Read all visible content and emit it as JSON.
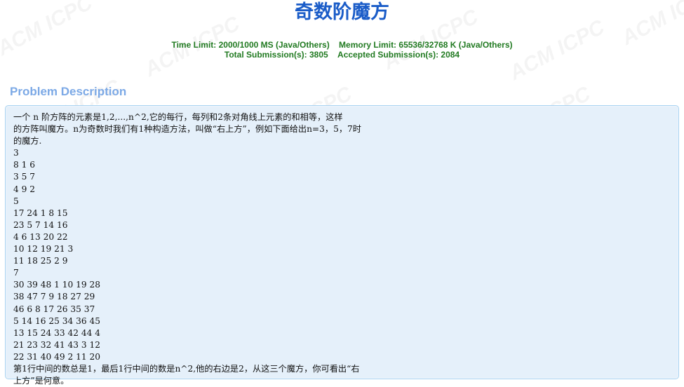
{
  "header": {
    "title": "奇数阶魔方",
    "time_limit": "Time Limit: 2000/1000 MS (Java/Others)",
    "memory_limit": "Memory Limit: 65536/32768 K (Java/Others)",
    "total_submissions": "Total Submission(s): 3805",
    "accepted_submissions": "Accepted Submission(s): 2084"
  },
  "watermark": "ACM ICPC",
  "problem": {
    "section_title": "Problem Description",
    "lines": [
      "一个 n 阶方阵的元素是1,2,...,n^2,它的每行，每列和2条对角线上元素的和相等，这样",
      "的方阵叫魔方。n为奇数时我们有1种构造方法，叫做“右上方”，例如下面给出n=3，5，7时",
      "的魔方.",
      "3",
      "8 1 6",
      "3 5 7",
      "4 9 2",
      "5",
      "17 24 1 8 15",
      "23 5 7 14 16",
      "4 6 13 20 22",
      "10 12 19 21 3",
      "11 18 25 2 9",
      "7",
      "30 39 48 1 10 19 28",
      "38 47 7 9 18 27 29",
      "46 6 8 17 26 35 37",
      "5 14 16 25 34 36 45",
      "13 15 24 33 42 44 4",
      "21 23 32 41 43 3 12",
      "22 31 40 49 2 11 20",
      "第1行中间的数总是1，最后1行中间的数是n^2,他的右边是2，从这三个魔方，你可看出“右",
      "上方”是何意。"
    ]
  }
}
